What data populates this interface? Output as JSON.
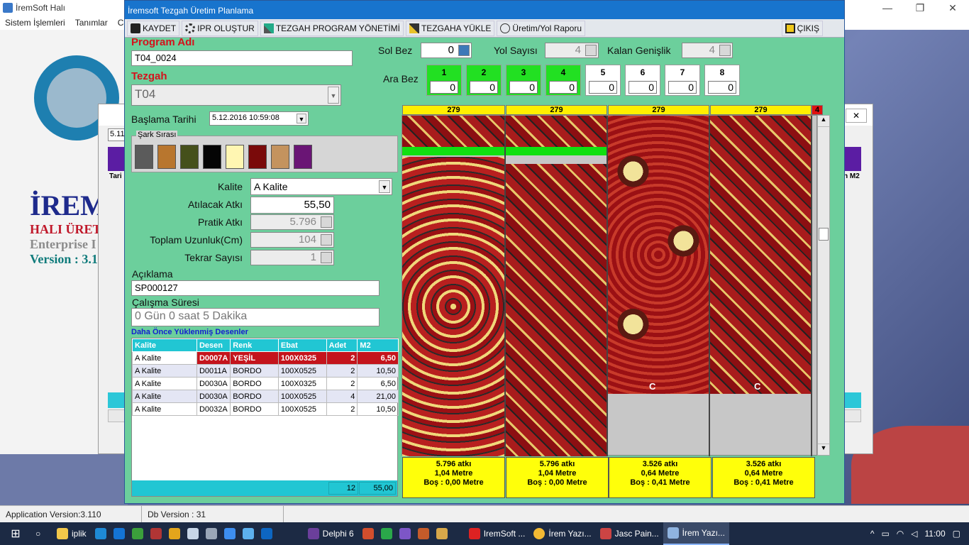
{
  "bg_app": {
    "title": "İremSoft Halı",
    "menu": [
      "Sistem İşlemleri",
      "Tanımlar",
      "Ce"
    ],
    "brand": {
      "line1": "İREM",
      "line2": "HALI ÜRET",
      "line3": "Enterprise I",
      "line4": "Version : 3.1"
    },
    "mid_dialog_field": "5.11",
    "mid_dialog_header_left": "Tari",
    "mid_dialog_header_right": "n M2"
  },
  "window": {
    "title": "İremsoft Tezgah Üretim Planlama",
    "toolbar": {
      "save": "KAYDET",
      "ipr": "IPR OLUŞTUR",
      "program": "TEZGAH PROGRAM YÖNETİMİ",
      "load": "TEZGAHA YÜKLE",
      "report": "Üretim/Yol Raporu",
      "exit": "ÇIKIŞ"
    }
  },
  "form": {
    "program_label": "Program Adı",
    "program_value": "T04_0024",
    "tezgah_label": "Tezgah",
    "tezgah_value": "T04",
    "start_label": "Başlama Tarihi",
    "start_value": "5.12.2016 10:59:08",
    "sarj_label": "Şark Sırası",
    "swatches": [
      "#5b5b5b",
      "#b8762e",
      "#45501b",
      "#050505",
      "#fff6b2",
      "#7a0a0a",
      "#c4935e",
      "#6a1575"
    ],
    "kalite_label": "Kalite",
    "kalite_value": "A Kalite",
    "atilacak_label": "Atılacak Atkı",
    "atilacak_value": "55,50",
    "pratik_label": "Pratik Atkı",
    "pratik_value": "5.796",
    "toplam_label": "Toplam Uzunluk(Cm)",
    "toplam_value": "104",
    "tekrar_label": "Tekrar Sayısı",
    "tekrar_value": "1",
    "aciklama_label": "Açıklama",
    "aciklama_value": "SP000127",
    "calisma_label": "Çalışma Süresi",
    "calisma_value": "0 Gün 0 saat 5 Dakika",
    "sol_bez_label": "Sol Bez",
    "sol_bez_value": "0",
    "yol_label": "Yol Sayısı",
    "yol_value": "4",
    "kalan_label": "Kalan Genişlik",
    "kalan_value": "4",
    "ara_bez_label": "Ara Bez",
    "ara_bez": [
      {
        "n": "1",
        "v": "0",
        "on": true
      },
      {
        "n": "2",
        "v": "0",
        "on": true
      },
      {
        "n": "3",
        "v": "0",
        "on": true
      },
      {
        "n": "4",
        "v": "0",
        "on": true
      },
      {
        "n": "5",
        "v": "0",
        "on": false
      },
      {
        "n": "6",
        "v": "0",
        "on": false
      },
      {
        "n": "7",
        "v": "0",
        "on": false
      },
      {
        "n": "8",
        "v": "0",
        "on": false
      }
    ]
  },
  "history": {
    "label": "Daha Önce Yüklenmiş Desenler",
    "columns": [
      "Kalite",
      "Desen",
      "Renk",
      "Ebat",
      "Adet",
      "M2"
    ],
    "rows": [
      [
        "A Kalite",
        "D0007A",
        "YEŞİL",
        "100X0325",
        "2",
        "6,50"
      ],
      [
        "A Kalite",
        "D0011A",
        "BORDO",
        "100X0525",
        "2",
        "10,50"
      ],
      [
        "A Kalite",
        "D0030A",
        "BORDO",
        "100X0325",
        "2",
        "6,50"
      ],
      [
        "A Kalite",
        "D0030A",
        "BORDO",
        "100X0525",
        "4",
        "21,00"
      ],
      [
        "A Kalite",
        "D0032A",
        "BORDO",
        "100X0525",
        "2",
        "10,50"
      ]
    ],
    "total_adet": "12",
    "total_m2": "55,00"
  },
  "loom": {
    "lane_widths": [
      "279",
      "279",
      "279",
      "279"
    ],
    "overflow_badge": "4",
    "corner_mark": "C",
    "footers": [
      {
        "atki": "5.796 atkı",
        "metre": "1,04 Metre",
        "bos": "Boş : 0,00 Metre"
      },
      {
        "atki": "5.796 atkı",
        "metre": "1,04 Metre",
        "bos": "Boş : 0,00 Metre"
      },
      {
        "atki": "3.526 atkı",
        "metre": "0,64 Metre",
        "bos": "Boş : 0,41 Metre"
      },
      {
        "atki": "3.526 atkı",
        "metre": "0,64 Metre",
        "bos": "Boş : 0,41 Metre"
      }
    ]
  },
  "statusbar": {
    "app_version": "Application Version:3.110",
    "db_version": "Db Version : 31"
  },
  "taskbar": {
    "items": [
      "iplik",
      "Delphi 6",
      "IremSoft ...",
      "İrem Yazı...",
      "Jasc Pain...",
      "İrem Yazı..."
    ],
    "time": "11:00"
  }
}
